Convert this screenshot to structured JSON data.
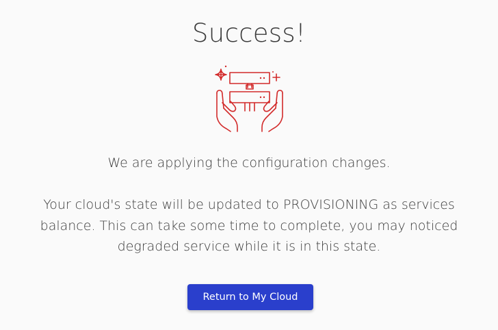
{
  "page": {
    "title": "Success!",
    "status_message": "We are applying the configuration changes.",
    "detail_message": "Your cloud's state will be updated to PROVISIONING as services balance. This can take some time to complete, you may noticed degraded service while it is in this state."
  },
  "illustration": {
    "icon": "hands-holding-server-icon",
    "color": "#d22a2a"
  },
  "actions": {
    "return_label": "Return to My Cloud"
  },
  "colors": {
    "accent": "#2a3fcc",
    "background": "#fafafa",
    "text": "#3a3a3a"
  }
}
